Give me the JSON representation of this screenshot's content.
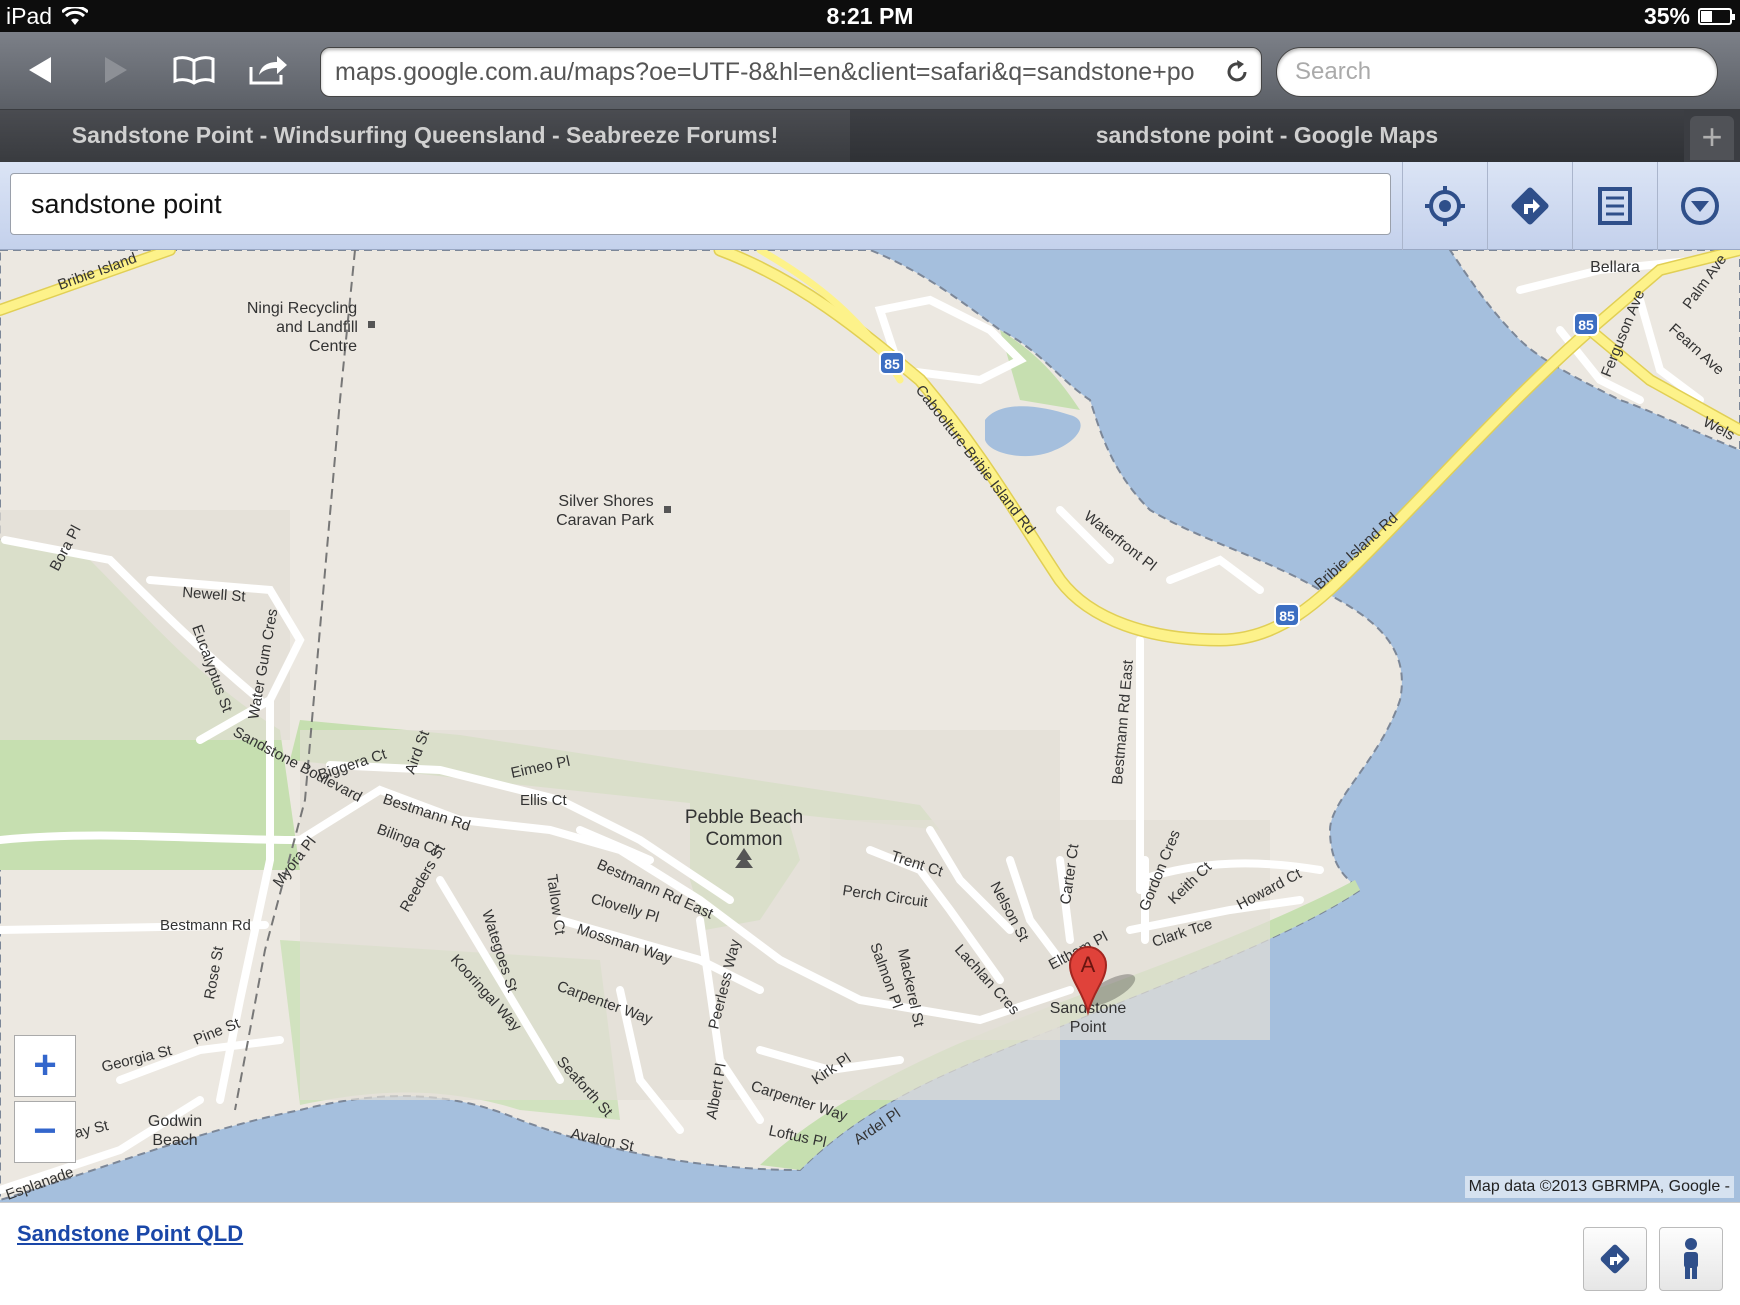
{
  "status_bar": {
    "device": "iPad",
    "time": "8:21 PM",
    "battery": "35%"
  },
  "browser": {
    "url": "maps.google.com.au/maps?oe=UTF-8&hl=en&client=safari&q=sandstone+po",
    "search_placeholder": "Search",
    "tabs": [
      {
        "title": "Sandstone Point - Windsurfing Queensland - Seabreeze Forums!",
        "active": false
      },
      {
        "title": "sandstone point - Google Maps",
        "active": true
      }
    ],
    "close_tab": "×",
    "new_tab": "+"
  },
  "maps": {
    "query": "sandstone point",
    "zoom_in": "+",
    "zoom_out": "−",
    "attribution": "Map data ©2013 GBRMPA, Google -",
    "marker_letter": "A",
    "places": {
      "bellara": "Bellara",
      "ningi1": "Ningi Recycling",
      "ningi2": "and Landfill",
      "ningi3": "Centre",
      "silver1": "Silver Shores",
      "silver2": "Caravan Park",
      "pebble1": "Pebble Beach",
      "pebble2": "Common",
      "sand1": "Sandstone",
      "sand2": "Point",
      "godwin1": "Godwin",
      "godwin2": "Beach"
    },
    "roads": {
      "bribie_left": "Bribie Island",
      "caboolture": "Caboolture-Bribie Island Rd",
      "bribie_rd": "Bribie Island Rd",
      "route": "85",
      "waterfront": "Waterfront Pl",
      "bestmann_east": "Bestmann Rd East",
      "bora": "Bora Pl",
      "newell": "Newell St",
      "eucalyptus": "Eucalyptus St",
      "watergum": "Water Gum Cres",
      "sandstone_blvd": "Sandstone Boulevard",
      "biggera": "Biggera Ct",
      "aird": "Aird St",
      "eimeo": "Eimeo Pl",
      "ellis": "Ellis Ct",
      "bestmann": "Bestmann Rd",
      "bilinga": "Bilinga Ct",
      "bestmann_east2": "Bestmann Rd East",
      "clovelly": "Clovelly Pl",
      "mossman": "Mossman Way",
      "tallow": "Tallow Ct",
      "reeders": "Reeders St",
      "wategoes": "Wategoes St",
      "myora": "Myora Pl",
      "bestmann_w": "Bestmann Rd",
      "rose": "Rose St",
      "pine": "Pine St",
      "georgia": "Georgia St",
      "kooringal": "Kooringal Way",
      "carpenter": "Carpenter Way",
      "peerless": "Peerless Way",
      "seaforth": "Seaforth St",
      "avalon": "Avalon St",
      "albert": "Albert Pl",
      "carpenter2": "Carpenter Way",
      "kirk": "Kirk Pl",
      "loftus": "Loftus Pl",
      "ardel": "Ardel Pl",
      "trent": "Trent Ct",
      "perch": "Perch Circuit",
      "salmon": "Salmon Pl",
      "mackerel": "Mackerel St",
      "lachlan": "Lachlan Cres",
      "nelson": "Nelson St",
      "carter": "Carter Ct",
      "eltham": "Eltham Pl",
      "gordon": "Gordon Cres",
      "keith": "Keith Ct",
      "howard": "Howard Ct",
      "clark": "Clark Tce",
      "palm": "Palm Ave",
      "ferguson": "Ferguson Ave",
      "fearn": "Fearn Ave",
      "wels": "Wels",
      "esplanade": "Esplanade",
      "ay": "ay St"
    }
  },
  "result": {
    "place": "Sandstone Point QLD"
  },
  "colors": {
    "water": "#a5bfdd",
    "land": "#ece8e1",
    "park": "#c6dfb0",
    "highway": "#fdf28a",
    "road": "#ffffff",
    "marker": "#e0423a",
    "link": "#1a47a8"
  }
}
